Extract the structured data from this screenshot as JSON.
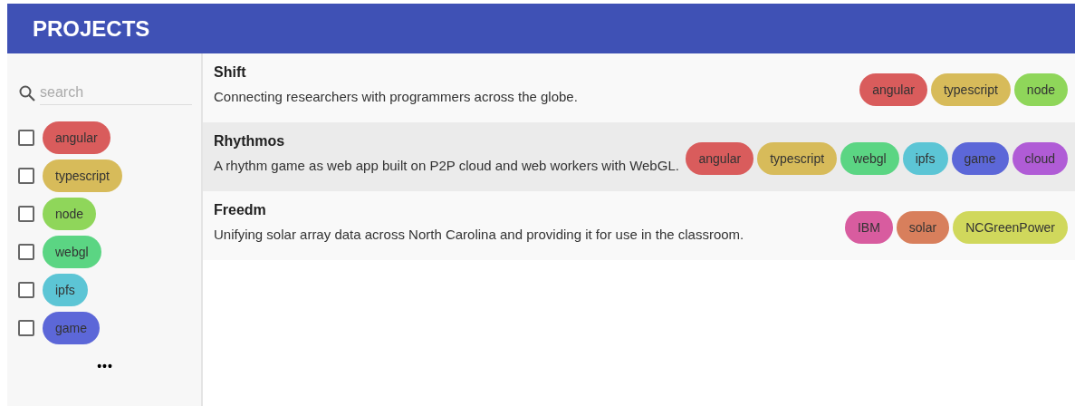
{
  "header": {
    "title": "PROJECTS"
  },
  "sidebar": {
    "search": {
      "placeholder": "search"
    },
    "filters": [
      {
        "label": "angular",
        "color": "#d95c5c",
        "checked": false
      },
      {
        "label": "typescript",
        "color": "#d7bb5a",
        "checked": false
      },
      {
        "label": "node",
        "color": "#8fd65a",
        "checked": false
      },
      {
        "label": "webgl",
        "color": "#5bd583",
        "checked": false
      },
      {
        "label": "ipfs",
        "color": "#5cc5d5",
        "checked": false
      },
      {
        "label": "game",
        "color": "#5c67d8",
        "checked": false
      }
    ],
    "more": "•••"
  },
  "projects": [
    {
      "name": "Shift",
      "description": "Connecting researchers with programmers across the globe.",
      "selected": false,
      "tags": [
        {
          "label": "angular",
          "color": "#d95c5c"
        },
        {
          "label": "typescript",
          "color": "#d7bb5a"
        },
        {
          "label": "node",
          "color": "#8fd65a"
        }
      ]
    },
    {
      "name": "Rhythmos",
      "description": "A rhythm game as web app built on P2P cloud and web workers with WebGL.",
      "selected": true,
      "tags": [
        {
          "label": "angular",
          "color": "#d95c5c"
        },
        {
          "label": "typescript",
          "color": "#d7bb5a"
        },
        {
          "label": "webgl",
          "color": "#5bd583"
        },
        {
          "label": "ipfs",
          "color": "#5cc5d5"
        },
        {
          "label": "game",
          "color": "#5c67d8"
        },
        {
          "label": "cloud",
          "color": "#b05cd6"
        }
      ]
    },
    {
      "name": "Freedm",
      "description": "Unifying solar array data across North Carolina and providing it for use in the classroom.",
      "selected": false,
      "tags": [
        {
          "label": "IBM",
          "color": "#d85c9f"
        },
        {
          "label": "solar",
          "color": "#d87f5c"
        },
        {
          "label": "NCGreenPower",
          "color": "#d0d85c"
        }
      ]
    }
  ]
}
